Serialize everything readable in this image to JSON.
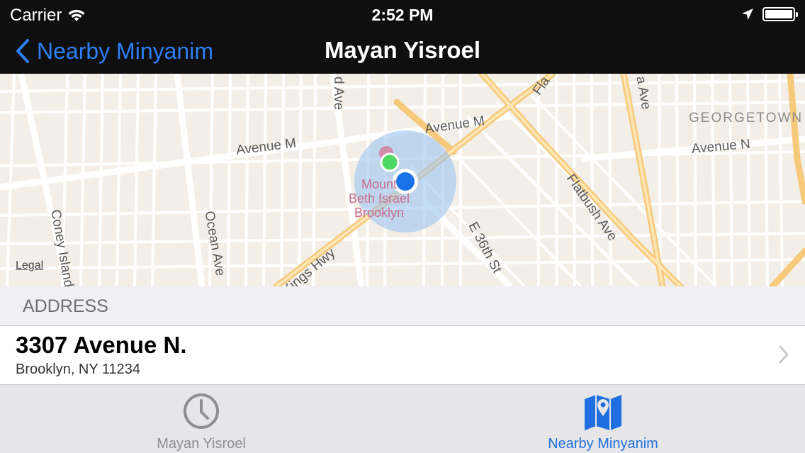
{
  "status_bar": {
    "carrier": "Carrier",
    "time": "2:52 PM"
  },
  "nav_bar": {
    "back_label": "Nearby Minyanim",
    "title": "Mayan Yisroel"
  },
  "map": {
    "streets": {
      "avenue_m_left": "Avenue M",
      "avenue_m_right": "Avenue M",
      "avenue_n": "Avenue N",
      "coney_island": "Coney Island",
      "ocean_ave": "Ocean Ave",
      "kings_hwy": "Kings Hwy",
      "e36th": "E 36th St",
      "flatbush_ave": "Flatbush Ave",
      "d_ave": "d Ave",
      "fla_top": "Fla",
      "a_ave_top": "a Ave",
      "neighborhood": "GEORGETOWN"
    },
    "poi_lines": [
      "Mount",
      "Beth Israel",
      "Brooklyn"
    ],
    "legal": "Legal",
    "colors": {
      "user_location": "#1a73e8",
      "pin": "#4cd964",
      "accuracy_circle": "#9cc3ef"
    }
  },
  "address_section": {
    "header": "ADDRESS",
    "line1": "3307 Avenue N.",
    "line2": "Brooklyn, NY 11234"
  },
  "tab_bar": {
    "tabs": [
      {
        "label": "Mayan Yisroel",
        "icon": "clock-icon",
        "active": false
      },
      {
        "label": "Nearby Minyanim",
        "icon": "map-pin-icon",
        "active": true
      }
    ]
  }
}
